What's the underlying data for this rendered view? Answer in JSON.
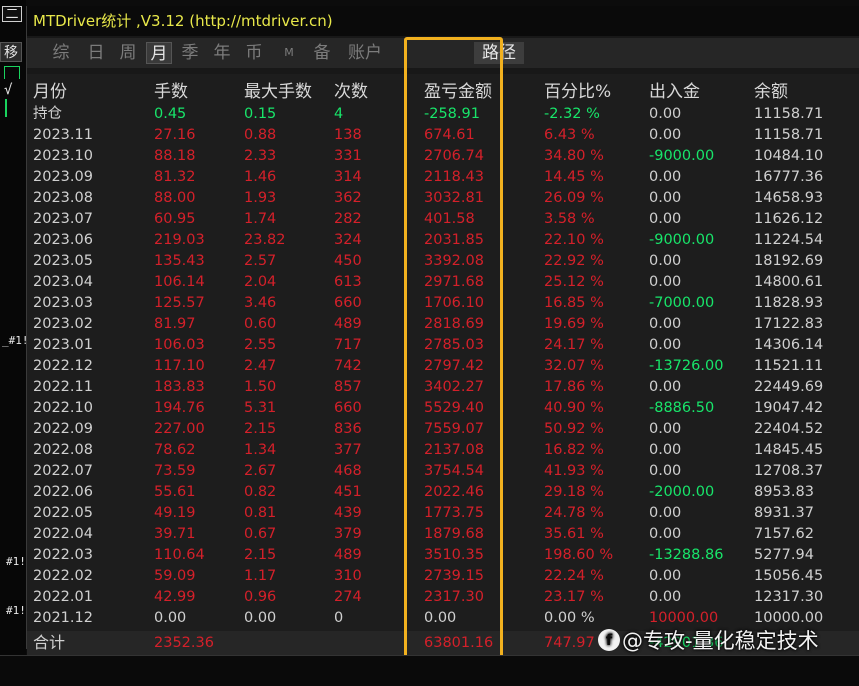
{
  "window": {
    "title": "MTDriver统计 ,V3.12 (http://mtdriver.cn)"
  },
  "left_strip": {
    "menu_label": "二",
    "move_label": "移",
    "marks": [
      "√",
      "_#1!",
      "#1!",
      "#1!"
    ]
  },
  "tabs": [
    {
      "label": "综",
      "active": false
    },
    {
      "label": "日",
      "active": false
    },
    {
      "label": "周",
      "active": false
    },
    {
      "label": "月",
      "active": true
    },
    {
      "label": "季",
      "active": false
    },
    {
      "label": "年",
      "active": false
    },
    {
      "label": "币",
      "active": false
    },
    {
      "label": "M",
      "active": false
    },
    {
      "label": "备",
      "active": false
    },
    {
      "label": "账户",
      "active": false
    },
    {
      "label": "路径",
      "active": false
    }
  ],
  "columns": [
    "月份",
    "手数",
    "最大手数",
    "次数",
    "盈亏金额",
    "百分比%",
    "出入金",
    "余额"
  ],
  "rows": [
    {
      "month": "持仓",
      "lots": "0.45",
      "max_lots": "0.15",
      "count": "4",
      "pnl": "-258.91",
      "pct": "-2.32 %",
      "flow": "0.00",
      "balance": "11158.71",
      "colors": [
        "w",
        "g",
        "g",
        "g",
        "g",
        "g",
        "w",
        "w"
      ]
    },
    {
      "month": "2023.11",
      "lots": "27.16",
      "max_lots": "0.88",
      "count": "138",
      "pnl": "674.61",
      "pct": "6.43 %",
      "flow": "0.00",
      "balance": "11158.71",
      "colors": [
        "w",
        "r",
        "r",
        "r",
        "r",
        "r",
        "w",
        "w"
      ]
    },
    {
      "month": "2023.10",
      "lots": "88.18",
      "max_lots": "2.33",
      "count": "331",
      "pnl": "2706.74",
      "pct": "34.80 %",
      "flow": "-9000.00",
      "balance": "10484.10",
      "colors": [
        "w",
        "r",
        "r",
        "r",
        "r",
        "r",
        "g",
        "w"
      ]
    },
    {
      "month": "2023.09",
      "lots": "81.32",
      "max_lots": "1.46",
      "count": "314",
      "pnl": "2118.43",
      "pct": "14.45 %",
      "flow": "0.00",
      "balance": "16777.36",
      "colors": [
        "w",
        "r",
        "r",
        "r",
        "r",
        "r",
        "w",
        "w"
      ]
    },
    {
      "month": "2023.08",
      "lots": "88.00",
      "max_lots": "1.93",
      "count": "362",
      "pnl": "3032.81",
      "pct": "26.09 %",
      "flow": "0.00",
      "balance": "14658.93",
      "colors": [
        "w",
        "r",
        "r",
        "r",
        "r",
        "r",
        "w",
        "w"
      ]
    },
    {
      "month": "2023.07",
      "lots": "60.95",
      "max_lots": "1.74",
      "count": "282",
      "pnl": "401.58",
      "pct": "3.58 %",
      "flow": "0.00",
      "balance": "11626.12",
      "colors": [
        "w",
        "r",
        "r",
        "r",
        "r",
        "r",
        "w",
        "w"
      ]
    },
    {
      "month": "2023.06",
      "lots": "219.03",
      "max_lots": "23.82",
      "count": "324",
      "pnl": "2031.85",
      "pct": "22.10 %",
      "flow": "-9000.00",
      "balance": "11224.54",
      "colors": [
        "w",
        "r",
        "r",
        "r",
        "r",
        "r",
        "g",
        "w"
      ]
    },
    {
      "month": "2023.05",
      "lots": "135.43",
      "max_lots": "2.57",
      "count": "450",
      "pnl": "3392.08",
      "pct": "22.92 %",
      "flow": "0.00",
      "balance": "18192.69",
      "colors": [
        "w",
        "r",
        "r",
        "r",
        "r",
        "r",
        "w",
        "w"
      ]
    },
    {
      "month": "2023.04",
      "lots": "106.14",
      "max_lots": "2.04",
      "count": "613",
      "pnl": "2971.68",
      "pct": "25.12 %",
      "flow": "0.00",
      "balance": "14800.61",
      "colors": [
        "w",
        "r",
        "r",
        "r",
        "r",
        "r",
        "w",
        "w"
      ]
    },
    {
      "month": "2023.03",
      "lots": "125.57",
      "max_lots": "3.46",
      "count": "660",
      "pnl": "1706.10",
      "pct": "16.85 %",
      "flow": "-7000.00",
      "balance": "11828.93",
      "colors": [
        "w",
        "r",
        "r",
        "r",
        "r",
        "r",
        "g",
        "w"
      ]
    },
    {
      "month": "2023.02",
      "lots": "81.97",
      "max_lots": "0.60",
      "count": "489",
      "pnl": "2818.69",
      "pct": "19.69 %",
      "flow": "0.00",
      "balance": "17122.83",
      "colors": [
        "w",
        "r",
        "r",
        "r",
        "r",
        "r",
        "w",
        "w"
      ]
    },
    {
      "month": "2023.01",
      "lots": "106.03",
      "max_lots": "2.55",
      "count": "717",
      "pnl": "2785.03",
      "pct": "24.17 %",
      "flow": "0.00",
      "balance": "14306.14",
      "colors": [
        "w",
        "r",
        "r",
        "r",
        "r",
        "r",
        "w",
        "w"
      ]
    },
    {
      "month": "2022.12",
      "lots": "117.10",
      "max_lots": "2.47",
      "count": "742",
      "pnl": "2797.42",
      "pct": "32.07 %",
      "flow": "-13726.00",
      "balance": "11521.11",
      "colors": [
        "w",
        "r",
        "r",
        "r",
        "r",
        "r",
        "g",
        "w"
      ]
    },
    {
      "month": "2022.11",
      "lots": "183.83",
      "max_lots": "1.50",
      "count": "857",
      "pnl": "3402.27",
      "pct": "17.86 %",
      "flow": "0.00",
      "balance": "22449.69",
      "colors": [
        "w",
        "r",
        "r",
        "r",
        "r",
        "r",
        "w",
        "w"
      ]
    },
    {
      "month": "2022.10",
      "lots": "194.76",
      "max_lots": "5.31",
      "count": "660",
      "pnl": "5529.40",
      "pct": "40.90 %",
      "flow": "-8886.50",
      "balance": "19047.42",
      "colors": [
        "w",
        "r",
        "r",
        "r",
        "r",
        "r",
        "g",
        "w"
      ]
    },
    {
      "month": "2022.09",
      "lots": "227.00",
      "max_lots": "2.15",
      "count": "836",
      "pnl": "7559.07",
      "pct": "50.92 %",
      "flow": "0.00",
      "balance": "22404.52",
      "colors": [
        "w",
        "r",
        "r",
        "r",
        "r",
        "r",
        "w",
        "w"
      ]
    },
    {
      "month": "2022.08",
      "lots": "78.62",
      "max_lots": "1.34",
      "count": "377",
      "pnl": "2137.08",
      "pct": "16.82 %",
      "flow": "0.00",
      "balance": "14845.45",
      "colors": [
        "w",
        "r",
        "r",
        "r",
        "r",
        "r",
        "w",
        "w"
      ]
    },
    {
      "month": "2022.07",
      "lots": "73.59",
      "max_lots": "2.67",
      "count": "468",
      "pnl": "3754.54",
      "pct": "41.93 %",
      "flow": "0.00",
      "balance": "12708.37",
      "colors": [
        "w",
        "r",
        "r",
        "r",
        "r",
        "r",
        "w",
        "w"
      ]
    },
    {
      "month": "2022.06",
      "lots": "55.61",
      "max_lots": "0.82",
      "count": "451",
      "pnl": "2022.46",
      "pct": "29.18 %",
      "flow": "-2000.00",
      "balance": "8953.83",
      "colors": [
        "w",
        "r",
        "r",
        "r",
        "r",
        "r",
        "g",
        "w"
      ]
    },
    {
      "month": "2022.05",
      "lots": "49.19",
      "max_lots": "0.81",
      "count": "439",
      "pnl": "1773.75",
      "pct": "24.78 %",
      "flow": "0.00",
      "balance": "8931.37",
      "colors": [
        "w",
        "r",
        "r",
        "r",
        "r",
        "r",
        "w",
        "w"
      ]
    },
    {
      "month": "2022.04",
      "lots": "39.71",
      "max_lots": "0.67",
      "count": "379",
      "pnl": "1879.68",
      "pct": "35.61 %",
      "flow": "0.00",
      "balance": "7157.62",
      "colors": [
        "w",
        "r",
        "r",
        "r",
        "r",
        "r",
        "w",
        "w"
      ]
    },
    {
      "month": "2022.03",
      "lots": "110.64",
      "max_lots": "2.15",
      "count": "489",
      "pnl": "3510.35",
      "pct": "198.60 %",
      "flow": "-13288.86",
      "balance": "5277.94",
      "colors": [
        "w",
        "r",
        "r",
        "r",
        "r",
        "r",
        "g",
        "w"
      ]
    },
    {
      "month": "2022.02",
      "lots": "59.09",
      "max_lots": "1.17",
      "count": "310",
      "pnl": "2739.15",
      "pct": "22.24 %",
      "flow": "0.00",
      "balance": "15056.45",
      "colors": [
        "w",
        "r",
        "r",
        "r",
        "r",
        "r",
        "w",
        "w"
      ]
    },
    {
      "month": "2022.01",
      "lots": "42.99",
      "max_lots": "0.96",
      "count": "274",
      "pnl": "2317.30",
      "pct": "23.17 %",
      "flow": "0.00",
      "balance": "12317.30",
      "colors": [
        "w",
        "r",
        "r",
        "r",
        "r",
        "r",
        "w",
        "w"
      ]
    },
    {
      "month": "2021.12",
      "lots": "0.00",
      "max_lots": "0.00",
      "count": "0",
      "pnl": "0.00",
      "pct": "0.00 %",
      "flow": "10000.00",
      "balance": "10000.00",
      "colors": [
        "w",
        "w",
        "w",
        "w",
        "w",
        "w",
        "r",
        "w"
      ]
    }
  ],
  "total": {
    "label": "合计",
    "lots": "2352.36",
    "pnl": "63801.16",
    "pct": "747.97 %",
    "flow": "-42901.36"
  },
  "watermark": {
    "icon": "f",
    "text": "@专攻-量化稳定技术"
  },
  "colors": {
    "red": "#d4202a",
    "green": "#18e56a",
    "white": "#d0d0d0",
    "title_yellow": "#e8e84a",
    "highlight": "#f2b11f"
  }
}
